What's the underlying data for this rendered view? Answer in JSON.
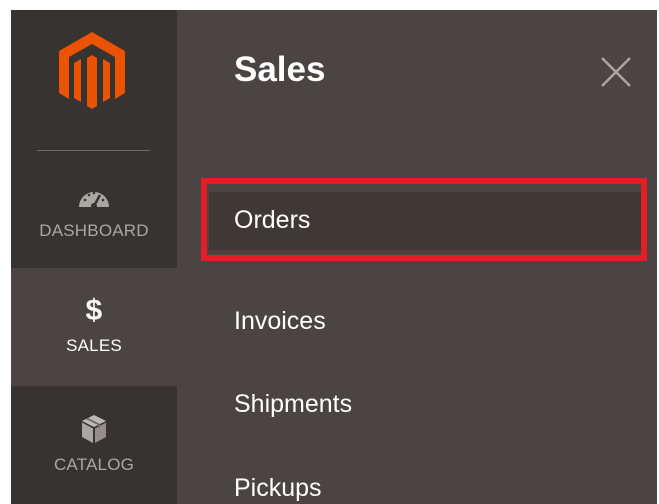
{
  "rail": {
    "logo_icon": "magento-logo-icon",
    "items": [
      {
        "label": "DASHBOARD",
        "icon": "speedometer-icon"
      },
      {
        "label": "SALES",
        "icon": "dollar-icon",
        "glyph": "$",
        "active": true
      },
      {
        "label": "CATALOG",
        "icon": "box-icon"
      }
    ]
  },
  "submenu": {
    "title": "Sales",
    "close_icon": "close-icon",
    "items": [
      {
        "label": "Orders",
        "highlighted": true
      },
      {
        "label": "Invoices"
      },
      {
        "label": "Shipments"
      },
      {
        "label": "Pickups"
      }
    ]
  },
  "colors": {
    "rail_bg": "#373330",
    "panel_bg": "#4a4542",
    "logo_orange": "#eb5202",
    "highlight_border": "#e41d26",
    "rail_text": "#aaa6a0",
    "active_text": "#ffffff"
  }
}
